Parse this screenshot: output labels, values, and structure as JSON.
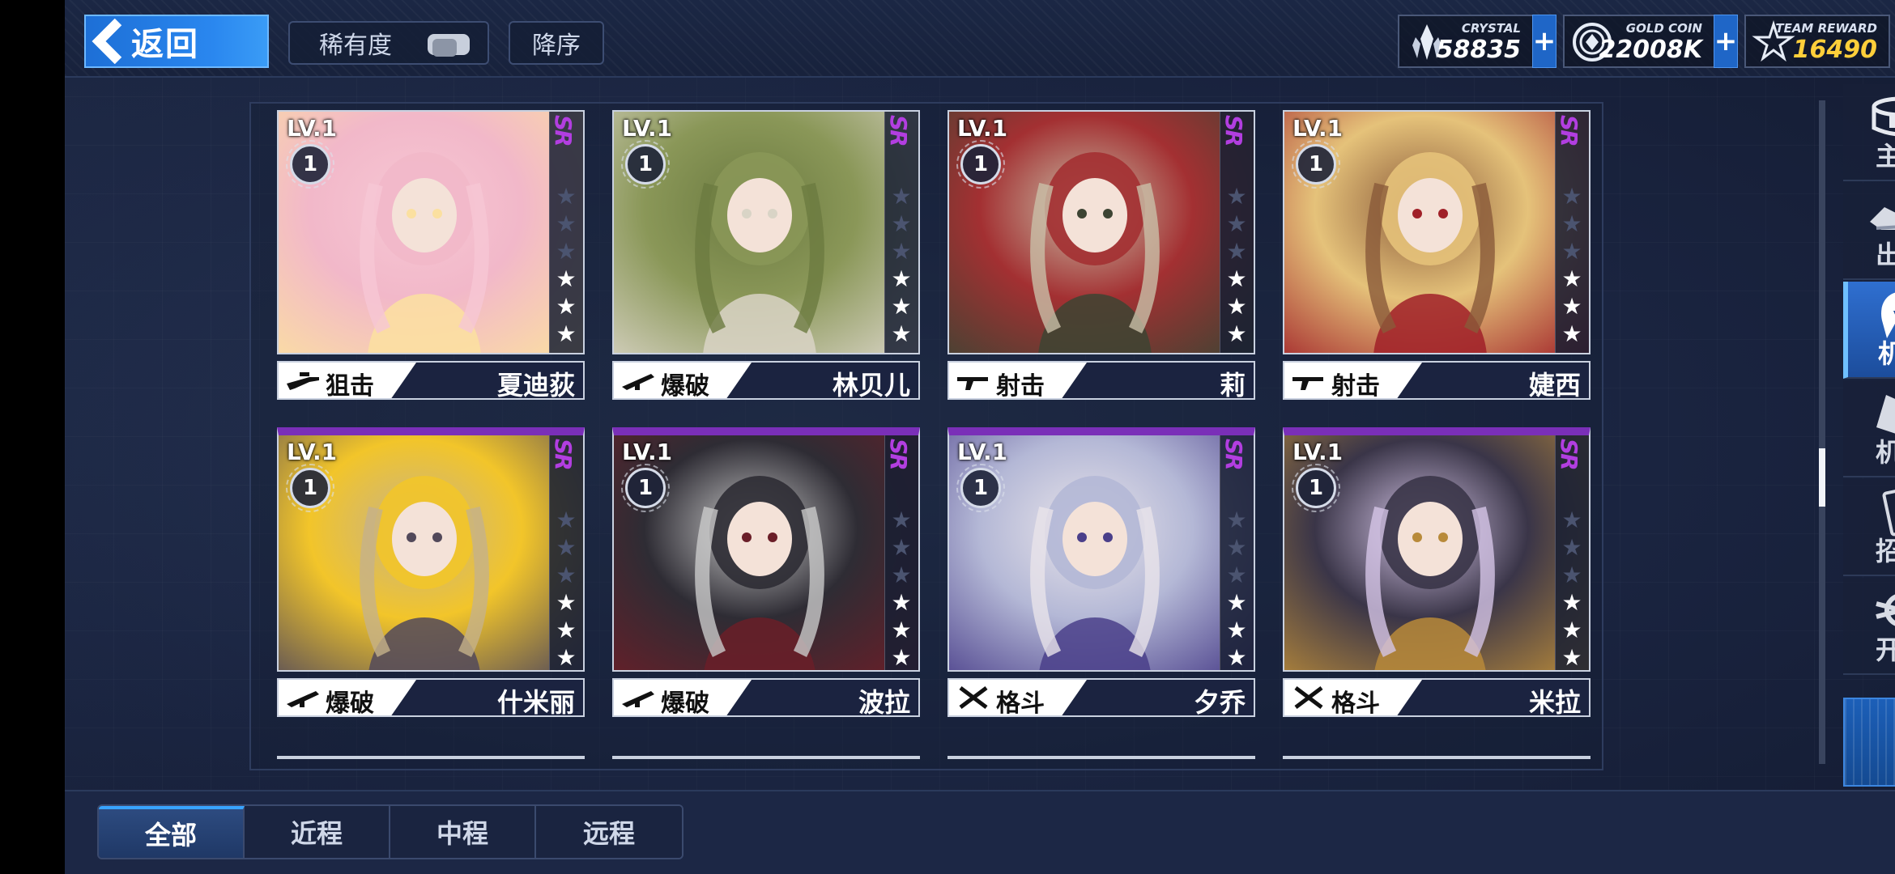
{
  "header": {
    "back_label": "返回",
    "rarity_label": "稀有度",
    "sort_label": "降序"
  },
  "resources": [
    {
      "label": "CRYSTAL",
      "value": "58835",
      "icon": "crystal-icon"
    },
    {
      "label": "GOLD COIN",
      "value": "22008K",
      "icon": "gold-coin-icon"
    },
    {
      "label": "TEAM REWARD",
      "value": "16490",
      "icon": "team-reward-icon"
    }
  ],
  "plus_symbol": "+",
  "cards": [
    {
      "level": "LV.1",
      "badge": "1",
      "rarity": "SR",
      "stars": 3,
      "type": "狙击",
      "type_icon": "sniper-rifle-icon",
      "name": "夏迪荻",
      "palette": [
        "#f6c7d4",
        "#f2b8c9",
        "#fbe0a0"
      ]
    },
    {
      "level": "LV.1",
      "badge": "1",
      "rarity": "SR",
      "stars": 3,
      "type": "爆破",
      "type_icon": "rocket-launcher-icon",
      "name": "林贝儿",
      "palette": [
        "#6b7a40",
        "#8a9758",
        "#d9d4c6"
      ]
    },
    {
      "level": "LV.1",
      "badge": "1",
      "rarity": "SR",
      "stars": 3,
      "type": "射击",
      "type_icon": "assault-rifle-icon",
      "name": "莉",
      "palette": [
        "#c9bfa8",
        "#a33032",
        "#3d4433"
      ]
    },
    {
      "level": "LV.1",
      "badge": "1",
      "rarity": "SR",
      "stars": 3,
      "type": "射击",
      "type_icon": "assault-rifle-icon",
      "name": "婕西",
      "palette": [
        "#8a5a3a",
        "#e5c27a",
        "#a02028"
      ]
    },
    {
      "level": "LV.1",
      "badge": "1",
      "rarity": "SR",
      "stars": 3,
      "type": "爆破",
      "type_icon": "rocket-launcher-icon",
      "name": "什米丽",
      "palette": [
        "#c6b28a",
        "#f2c52a",
        "#52495a"
      ]
    },
    {
      "level": "LV.1",
      "badge": "1",
      "rarity": "SR",
      "stars": 3,
      "type": "爆破",
      "type_icon": "rocket-launcher-icon",
      "name": "波拉",
      "palette": [
        "#c9c9c9",
        "#2e2c34",
        "#6a1e28"
      ]
    },
    {
      "level": "LV.1",
      "badge": "1",
      "rarity": "SR",
      "stars": 3,
      "type": "格斗",
      "type_icon": "crossed-swords-icon",
      "name": "夕乔",
      "palette": [
        "#e8e4ea",
        "#b4b8d6",
        "#4a3f8a"
      ]
    },
    {
      "level": "LV.1",
      "badge": "1",
      "rarity": "SR",
      "stars": 3,
      "type": "格斗",
      "type_icon": "crossed-swords-icon",
      "name": "米拉",
      "palette": [
        "#d4c4e6",
        "#3a3548",
        "#b88a3a"
      ]
    }
  ],
  "nav": [
    {
      "label": "主厅",
      "icon": "hall-icon"
    },
    {
      "label": "出战",
      "icon": "battle-icon"
    },
    {
      "label": "机师",
      "icon": "pilot-icon"
    },
    {
      "label": "机库",
      "icon": "hangar-icon"
    },
    {
      "label": "招募",
      "icon": "recruit-icon"
    },
    {
      "label": "开发",
      "icon": "develop-icon"
    }
  ],
  "tabs": [
    "全部",
    "近程",
    "中程",
    "远程"
  ],
  "colors": {
    "accent_blue": "#2a87ef",
    "rarity_purple": "#b23ee0",
    "gold": "#ffcf3a"
  }
}
